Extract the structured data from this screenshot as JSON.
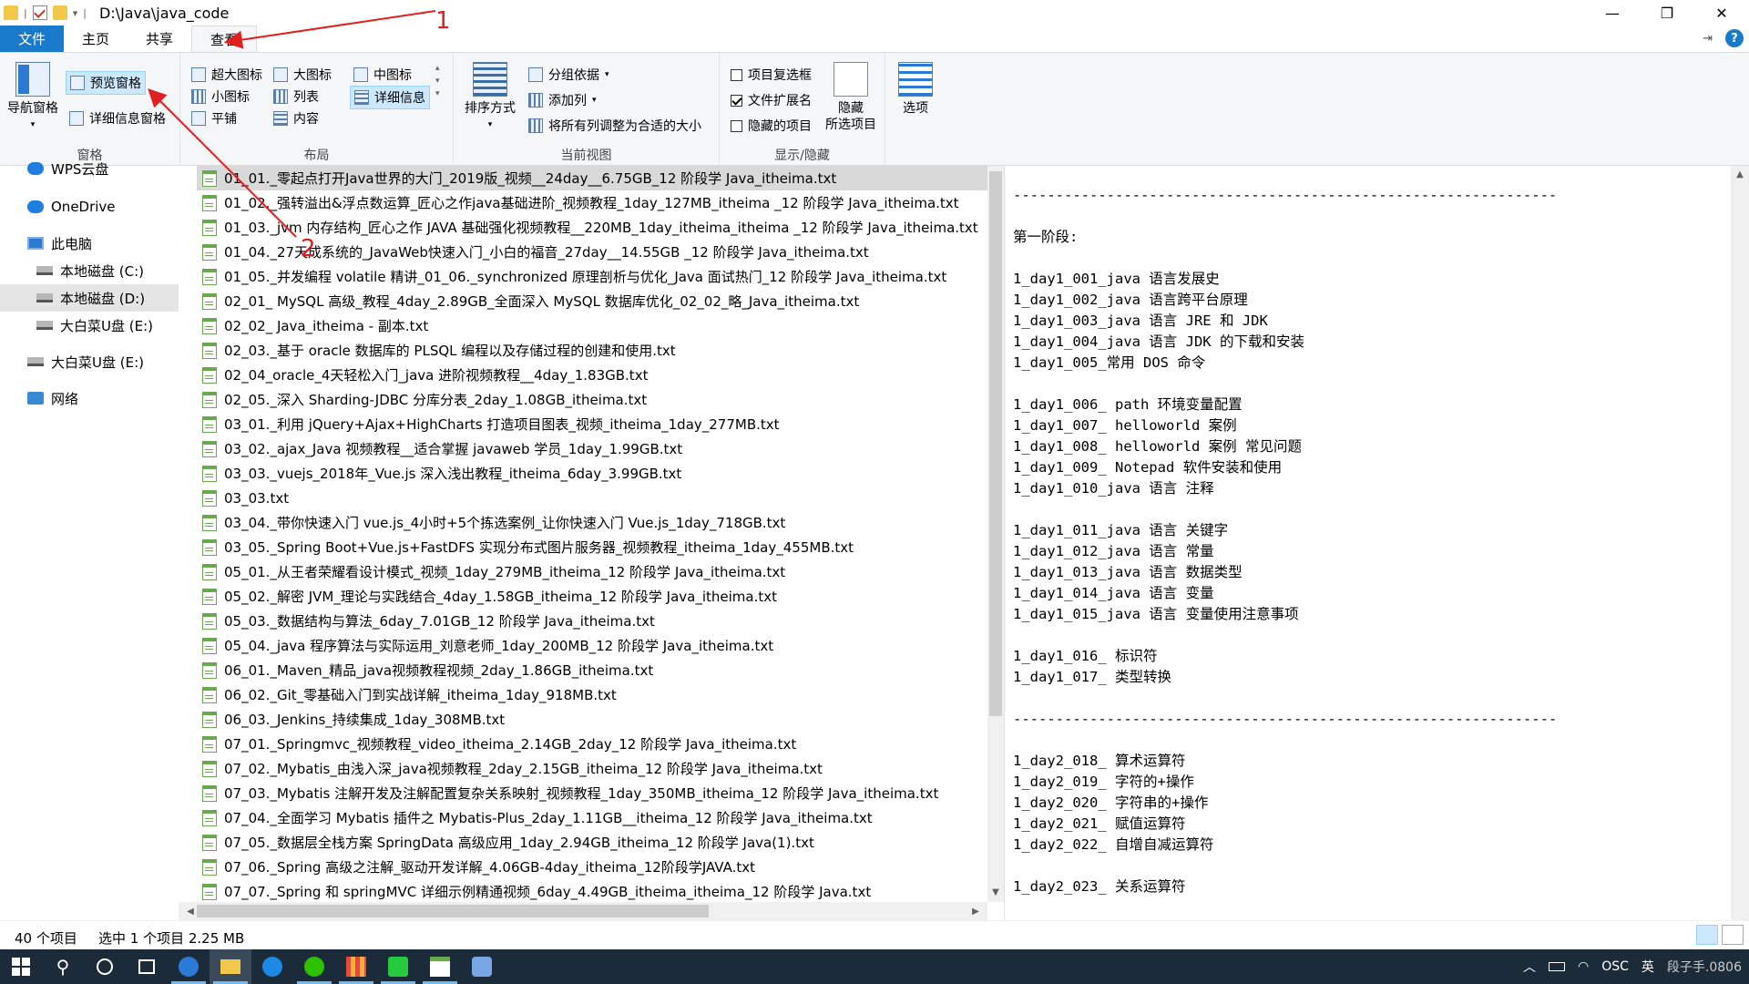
{
  "window": {
    "path_title": "D:\\Java\\java_code",
    "minimize": "—",
    "maximize": "❐",
    "close": "✕"
  },
  "tabs": [
    {
      "label": "文件"
    },
    {
      "label": "主页"
    },
    {
      "label": "共享"
    },
    {
      "label": "查看"
    }
  ],
  "ribbon": {
    "panes": {
      "nav_pane": "导航窗格",
      "preview_pane": "预览窗格",
      "details_pane": "详细信息窗格",
      "group_label": "窗格"
    },
    "layout": {
      "extra_large": "超大图标",
      "large": "大图标",
      "medium": "中图标",
      "small": "小图标",
      "list": "列表",
      "details": "详细信息",
      "tiles": "平铺",
      "content": "内容",
      "group_label": "布局"
    },
    "current_view": {
      "sort_by": "排序方式",
      "group_by": "分组依据",
      "add_column": "添加列",
      "size_all_columns": "将所有列调整为合适的大小",
      "group_label": "当前视图"
    },
    "show_hide": {
      "item_checkboxes": "项目复选框",
      "file_extensions": "文件扩展名",
      "hidden_items": "隐藏的项目",
      "hide_selected": "隐藏\n所选项目",
      "group_label": "显示/隐藏",
      "item_checkboxes_checked": false,
      "file_extensions_checked": true,
      "hidden_items_checked": false
    },
    "options": "选项"
  },
  "nav": [
    {
      "label": "WPS云盘"
    },
    {
      "label": "OneDrive"
    },
    {
      "label": "此电脑"
    },
    {
      "label": "本地磁盘 (C:)"
    },
    {
      "label": "本地磁盘 (D:)"
    },
    {
      "label": "大白菜U盘 (E:)"
    },
    {
      "label": "大白菜U盘 (E:)"
    },
    {
      "label": "网络"
    }
  ],
  "files": [
    "01_01._零起点打开Java世界的大门_2019版_视频__24day__6.75GB_12 阶段学 Java_itheima.txt",
    "01_02._强转溢出&浮点数运算_匠心之作java基础进阶_视频教程_1day_127MB_itheima _12 阶段学 Java_itheima.txt",
    "01_03._jvm 内存结构_匠心之作 JAVA 基础强化视频教程__220MB_1day_itheima_itheima _12 阶段学 Java_itheima.txt",
    "01_04._27天成系统的_JavaWeb快速入门_小白的福音_27day__14.55GB _12 阶段学 Java_itheima.txt",
    "01_05._并发编程 volatile 精讲_01_06._synchronized 原理剖析与优化_Java 面试热门_12 阶段学 Java_itheima.txt",
    "02_01_ MySQL 高级_教程_4day_2.89GB_全面深入 MySQL 数据库优化_02_02_略_Java_itheima.txt",
    "02_02_ Java_itheima - 副本.txt",
    "02_03._基于 oracle 数据库的 PLSQL 编程以及存储过程的创建和使用.txt",
    "02_04_oracle_4天轻松入门_java 进阶视频教程__4day_1.83GB.txt",
    "02_05._深入 Sharding-JDBC 分库分表_2day_1.08GB_itheima.txt",
    "03_01._利用 jQuery+Ajax+HighCharts 打造项目图表_视频_itheima_1day_277MB.txt",
    "03_02._ajax_Java 视频教程__适合掌握 javaweb 学员_1day_1.99GB.txt",
    "03_03._vuejs_2018年_Vue.js 深入浅出教程_itheima_6day_3.99GB.txt",
    "03_03.txt",
    "03_04._带你快速入门 vue.js_4小时+5个拣选案例_让你快速入门 Vue.js_1day_718GB.txt",
    "03_05._Spring Boot+Vue.js+FastDFS 实现分布式图片服务器_视频教程_itheima_1day_455MB.txt",
    "05_01._从王者荣耀看设计模式_视频_1day_279MB_itheima_12 阶段学 Java_itheima.txt",
    "05_02._解密 JVM_理论与实践结合_4day_1.58GB_itheima_12 阶段学 Java_itheima.txt",
    "05_03._数据结构与算法_6day_7.01GB_12 阶段学 Java_itheima.txt",
    "05_04._java 程序算法与实际运用_刘意老师_1day_200MB_12 阶段学 Java_itheima.txt",
    "06_01._Maven_精品_java视频教程视频_2day_1.86GB_itheima.txt",
    "06_02._Git_零基础入门到实战详解_itheima_1day_918MB.txt",
    "06_03._Jenkins_持续集成_1day_308MB.txt",
    "07_01._Springmvc_视频教程_video_itheima_2.14GB_2day_12 阶段学 Java_itheima.txt",
    "07_02._Mybatis_由浅入深_java视频教程_2day_2.15GB_itheima_12 阶段学 Java_itheima.txt",
    "07_03._Mybatis 注解开发及注解配置复杂关系映射_视频教程_1day_350MB_itheima_12 阶段学 Java_itheima.txt",
    "07_04._全面学习 Mybatis 插件之 Mybatis-Plus_2day_1.11GB__itheima_12 阶段学 Java_itheima.txt",
    "07_05._数据层全栈方案 SpringData 高级应用_1day_2.94GB_itheima_12 阶段学 Java(1).txt",
    "07_06._Spring 高级之注解_驱动开发详解_4.06GB-4day_itheima_12阶段学JAVA.txt",
    "07_07._Spring 和 springMVC 详细示例精通视频_6day_4.49GB_itheima_itheima_12 阶段学 Java.txt"
  ],
  "preview_lines": [
    "",
    "----------------------------------------------------------------",
    "",
    "第一阶段:",
    "",
    "1_day1_001_java 语言发展史",
    "1_day1_002_java 语言跨平台原理",
    "1_day1_003_java 语言 JRE 和 JDK",
    "1_day1_004_java 语言 JDK 的下载和安装",
    "1_day1_005_常用 DOS 命令",
    "",
    "1_day1_006_ path 环境变量配置",
    "1_day1_007_ helloworld 案例",
    "1_day1_008_ helloworld 案例 常见问题",
    "1_day1_009_ Notepad 软件安装和使用",
    "1_day1_010_java 语言 注释",
    "",
    "1_day1_011_java 语言 关键字",
    "1_day1_012_java 语言 常量",
    "1_day1_013_java 语言 数据类型",
    "1_day1_014_java 语言 变量",
    "1_day1_015_java 语言 变量使用注意事项",
    "",
    "1_day1_016_ 标识符",
    "1_day1_017_ 类型转换",
    "",
    "----------------------------------------------------------------",
    "",
    "1_day2_018_ 算术运算符",
    "1_day2_019_ 字符的+操作",
    "1_day2_020_ 字符串的+操作",
    "1_day2_021_ 赋值运算符",
    "1_day2_022_ 自增自减运算符",
    "",
    "1_day2_023_ 关系运算符"
  ],
  "status": {
    "item_count": "40 个项目",
    "selected": "选中 1 个项目  2.25 MB"
  },
  "tray": {
    "ime": "英",
    "watermark": "段子手.0806",
    "osc": "OSC"
  },
  "annotations": {
    "label_1": "1",
    "label_2": "2"
  },
  "colors": {
    "accent": "#1979ca",
    "selection": "#cce8ff",
    "annotation": "#e02020"
  }
}
